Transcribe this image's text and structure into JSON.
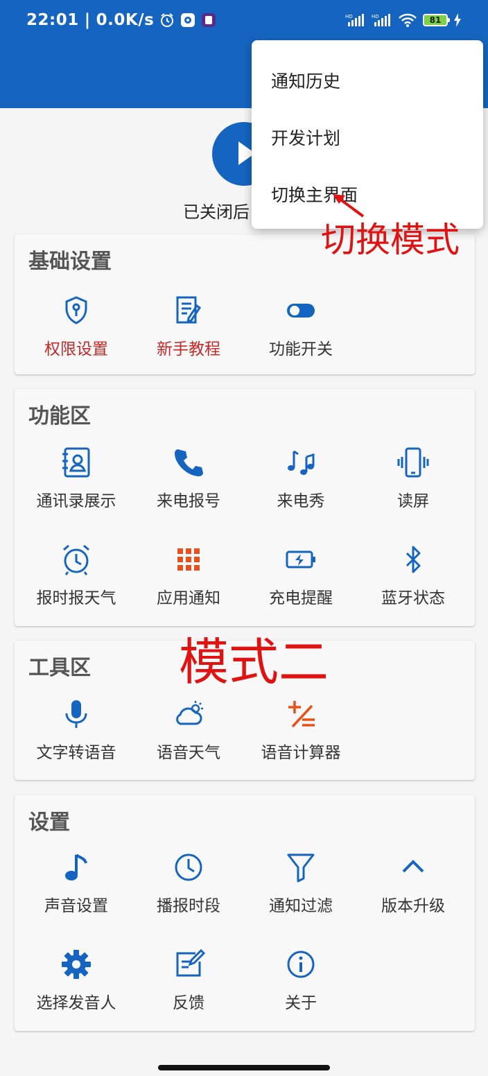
{
  "status_bar": {
    "time": "22:01",
    "network_speed": "0.0K/s",
    "battery_level": "81",
    "icons": [
      "alarm-icon",
      "gear-app-icon",
      "app-icon",
      "hd-signal-icon",
      "hd-signal-icon",
      "wifi-icon",
      "battery-icon",
      "charging-icon"
    ]
  },
  "service": {
    "status_text": "已关闭后"
  },
  "menu": {
    "items": [
      {
        "label": "通知历史"
      },
      {
        "label": "开发计划"
      },
      {
        "label": "切换主界面"
      }
    ]
  },
  "annotations": {
    "arrow_label": "切换模式",
    "mode_label": "模式二"
  },
  "sections": {
    "basic": {
      "title": "基础设置",
      "items": [
        {
          "label": "权限设置",
          "icon": "shield-key-icon"
        },
        {
          "label": "新手教程",
          "icon": "tutorial-icon"
        },
        {
          "label": "功能开关",
          "icon": "toggle-icon"
        }
      ]
    },
    "features": {
      "title": "功能区",
      "items": [
        {
          "label": "通讯录展示",
          "icon": "contacts-icon"
        },
        {
          "label": "来电报号",
          "icon": "phone-icon"
        },
        {
          "label": "来电秀",
          "icon": "music-notes-icon"
        },
        {
          "label": "读屏",
          "icon": "phone-vibrate-icon"
        },
        {
          "label": "报时报天气",
          "icon": "alarm-clock-icon"
        },
        {
          "label": "应用通知",
          "icon": "apps-grid-icon"
        },
        {
          "label": "充电提醒",
          "icon": "battery-charging-icon"
        },
        {
          "label": "蓝牙状态",
          "icon": "bluetooth-icon"
        }
      ]
    },
    "tools": {
      "title": "工具区",
      "items": [
        {
          "label": "文字转语音",
          "icon": "microphone-icon"
        },
        {
          "label": "语音天气",
          "icon": "weather-icon"
        },
        {
          "label": "语音计算器",
          "icon": "calculator-icon"
        }
      ]
    },
    "settings": {
      "title": "设置",
      "items": [
        {
          "label": "声音设置",
          "icon": "music-note-icon"
        },
        {
          "label": "播报时段",
          "icon": "clock-icon"
        },
        {
          "label": "通知过滤",
          "icon": "filter-icon"
        },
        {
          "label": "版本升级",
          "icon": "chevron-up-icon"
        },
        {
          "label": "选择发音人",
          "icon": "gear-icon"
        },
        {
          "label": "反馈",
          "icon": "edit-icon"
        },
        {
          "label": "关于",
          "icon": "info-icon"
        }
      ]
    }
  },
  "colors": {
    "primary": "#1565c0",
    "alert": "#c62828",
    "annotation": "#e01212",
    "accent_orange": "#e8501a"
  }
}
